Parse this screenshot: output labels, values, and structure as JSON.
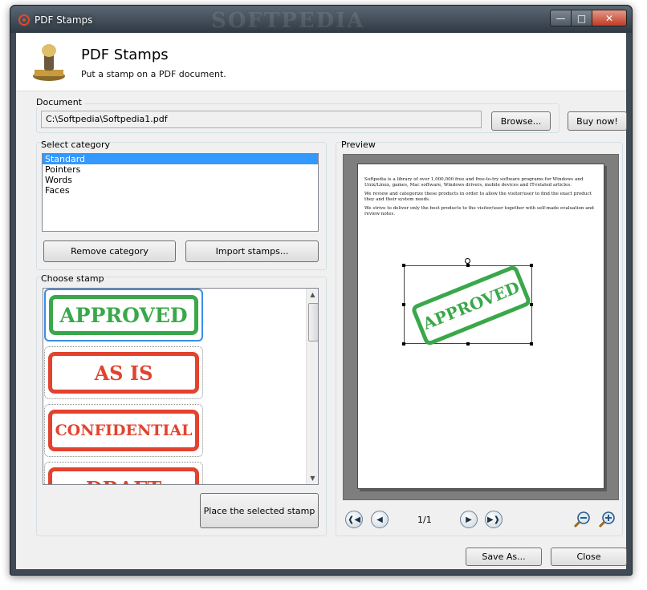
{
  "window": {
    "title": "PDF Stamps",
    "watermark": "SOFTPEDIA"
  },
  "header": {
    "title": "PDF Stamps",
    "subtitle": "Put a stamp on a PDF document."
  },
  "document": {
    "label": "Document",
    "path": "C:\\Softpedia\\Softpedia1.pdf",
    "browse_label": "Browse...",
    "buy_label": "Buy now!"
  },
  "category": {
    "label": "Select category",
    "items": [
      "Standard",
      "Pointers",
      "Words",
      "Faces"
    ],
    "selected": "Standard",
    "remove_label": "Remove category",
    "import_label": "Import stamps..."
  },
  "stamps": {
    "label": "Choose stamp",
    "items": [
      "APPROVED",
      "AS IS",
      "CONFIDENTIAL",
      "DRAFT"
    ],
    "place_label": "Place the selected stamp"
  },
  "preview": {
    "label": "Preview",
    "paragraphs": [
      "Softpedia is a library of over 1,000,000 free and free-to-try software programs for Windows and Unix/Linux, games, Mac software, Windows drivers, mobile devices and IT-related articles.",
      "We review and categorize these products in order to allow the visitor/user to find the exact product they and their system needs.",
      "We strive to deliver only the best products to the visitor/user together with self-made evaluation and review notes."
    ],
    "placed_stamp": "APPROVED",
    "page_indicator": "1/1"
  },
  "footer": {
    "save_label": "Save As...",
    "close_label": "Close"
  },
  "colors": {
    "stamp_green": "#3aa84a",
    "stamp_red": "#e2432e",
    "selection": "#3399ff"
  }
}
